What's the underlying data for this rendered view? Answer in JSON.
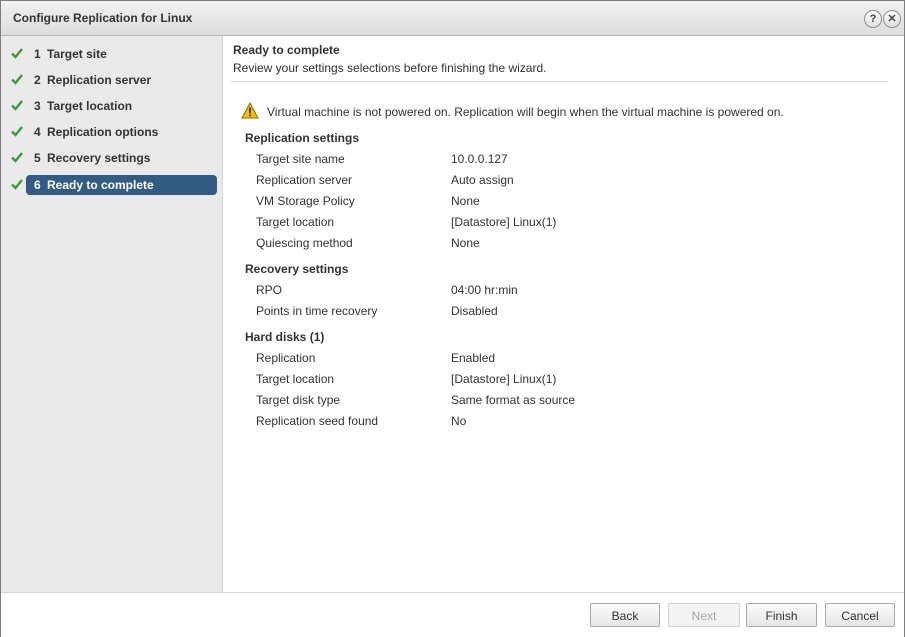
{
  "window": {
    "title": "Configure Replication for Linux",
    "help_glyph": "?",
    "close_glyph": "✕"
  },
  "steps": [
    {
      "num": "1",
      "label": "Target site",
      "completed": true
    },
    {
      "num": "2",
      "label": "Replication server",
      "completed": true
    },
    {
      "num": "3",
      "label": "Target location",
      "completed": true
    },
    {
      "num": "4",
      "label": "Replication options",
      "completed": true
    },
    {
      "num": "5",
      "label": "Recovery settings",
      "completed": true
    },
    {
      "num": "6",
      "label": "Ready to complete",
      "completed": true,
      "active": true
    }
  ],
  "header": {
    "title": "Ready to complete",
    "subtitle": "Review your settings selections before finishing the wizard."
  },
  "warning": {
    "icon": "warning-icon",
    "text": "Virtual machine is not powered on. Replication will begin when the virtual machine is powered on."
  },
  "sections": {
    "replication": {
      "title": "Replication settings",
      "rows": [
        {
          "key": "Target site name",
          "value": "10.0.0.127"
        },
        {
          "key": "Replication server",
          "value": "Auto assign"
        },
        {
          "key": "VM Storage Policy",
          "value": "None"
        },
        {
          "key": "Target location",
          "value": "[Datastore] Linux(1)"
        },
        {
          "key": "Quiescing method",
          "value": "None"
        }
      ]
    },
    "recovery": {
      "title": "Recovery settings",
      "rows": [
        {
          "key": "RPO",
          "value": "04:00 hr:min"
        },
        {
          "key": "Points in time recovery",
          "value": "Disabled"
        }
      ]
    },
    "disks": {
      "title": "Hard disks (1)",
      "rows": [
        {
          "key": "Replication",
          "value": "Enabled"
        },
        {
          "key": "Target location",
          "value": "[Datastore] Linux(1)"
        },
        {
          "key": "Target disk type",
          "value": "Same format as source"
        },
        {
          "key": "Replication seed found",
          "value": "No"
        }
      ]
    }
  },
  "footer": {
    "back": "Back",
    "next": "Next",
    "finish": "Finish",
    "cancel": "Cancel",
    "next_enabled": false
  },
  "colors": {
    "active_step": "#335c85",
    "check": "#3a9a3a",
    "warning": "#f2c200"
  }
}
